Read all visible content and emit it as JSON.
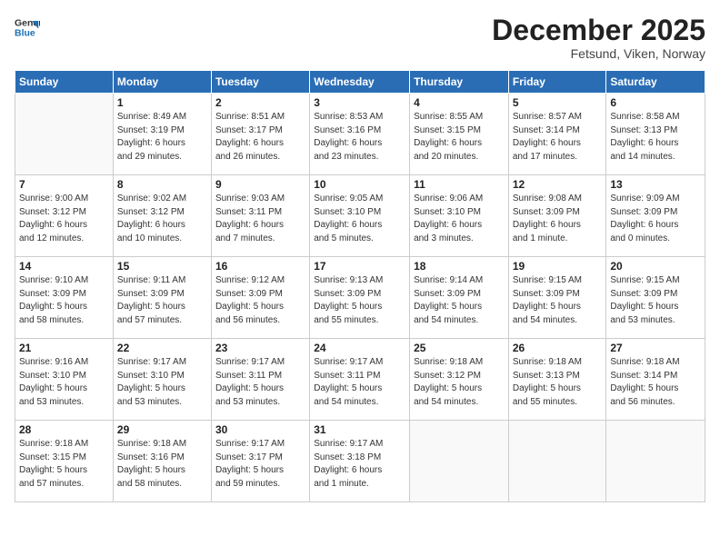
{
  "header": {
    "logo_line1": "General",
    "logo_line2": "Blue",
    "month": "December 2025",
    "location": "Fetsund, Viken, Norway"
  },
  "weekdays": [
    "Sunday",
    "Monday",
    "Tuesday",
    "Wednesday",
    "Thursday",
    "Friday",
    "Saturday"
  ],
  "weeks": [
    [
      {
        "day": "",
        "info": ""
      },
      {
        "day": "1",
        "info": "Sunrise: 8:49 AM\nSunset: 3:19 PM\nDaylight: 6 hours\nand 29 minutes."
      },
      {
        "day": "2",
        "info": "Sunrise: 8:51 AM\nSunset: 3:17 PM\nDaylight: 6 hours\nand 26 minutes."
      },
      {
        "day": "3",
        "info": "Sunrise: 8:53 AM\nSunset: 3:16 PM\nDaylight: 6 hours\nand 23 minutes."
      },
      {
        "day": "4",
        "info": "Sunrise: 8:55 AM\nSunset: 3:15 PM\nDaylight: 6 hours\nand 20 minutes."
      },
      {
        "day": "5",
        "info": "Sunrise: 8:57 AM\nSunset: 3:14 PM\nDaylight: 6 hours\nand 17 minutes."
      },
      {
        "day": "6",
        "info": "Sunrise: 8:58 AM\nSunset: 3:13 PM\nDaylight: 6 hours\nand 14 minutes."
      }
    ],
    [
      {
        "day": "7",
        "info": "Sunrise: 9:00 AM\nSunset: 3:12 PM\nDaylight: 6 hours\nand 12 minutes."
      },
      {
        "day": "8",
        "info": "Sunrise: 9:02 AM\nSunset: 3:12 PM\nDaylight: 6 hours\nand 10 minutes."
      },
      {
        "day": "9",
        "info": "Sunrise: 9:03 AM\nSunset: 3:11 PM\nDaylight: 6 hours\nand 7 minutes."
      },
      {
        "day": "10",
        "info": "Sunrise: 9:05 AM\nSunset: 3:10 PM\nDaylight: 6 hours\nand 5 minutes."
      },
      {
        "day": "11",
        "info": "Sunrise: 9:06 AM\nSunset: 3:10 PM\nDaylight: 6 hours\nand 3 minutes."
      },
      {
        "day": "12",
        "info": "Sunrise: 9:08 AM\nSunset: 3:09 PM\nDaylight: 6 hours\nand 1 minute."
      },
      {
        "day": "13",
        "info": "Sunrise: 9:09 AM\nSunset: 3:09 PM\nDaylight: 6 hours\nand 0 minutes."
      }
    ],
    [
      {
        "day": "14",
        "info": "Sunrise: 9:10 AM\nSunset: 3:09 PM\nDaylight: 5 hours\nand 58 minutes."
      },
      {
        "day": "15",
        "info": "Sunrise: 9:11 AM\nSunset: 3:09 PM\nDaylight: 5 hours\nand 57 minutes."
      },
      {
        "day": "16",
        "info": "Sunrise: 9:12 AM\nSunset: 3:09 PM\nDaylight: 5 hours\nand 56 minutes."
      },
      {
        "day": "17",
        "info": "Sunrise: 9:13 AM\nSunset: 3:09 PM\nDaylight: 5 hours\nand 55 minutes."
      },
      {
        "day": "18",
        "info": "Sunrise: 9:14 AM\nSunset: 3:09 PM\nDaylight: 5 hours\nand 54 minutes."
      },
      {
        "day": "19",
        "info": "Sunrise: 9:15 AM\nSunset: 3:09 PM\nDaylight: 5 hours\nand 54 minutes."
      },
      {
        "day": "20",
        "info": "Sunrise: 9:15 AM\nSunset: 3:09 PM\nDaylight: 5 hours\nand 53 minutes."
      }
    ],
    [
      {
        "day": "21",
        "info": "Sunrise: 9:16 AM\nSunset: 3:10 PM\nDaylight: 5 hours\nand 53 minutes."
      },
      {
        "day": "22",
        "info": "Sunrise: 9:17 AM\nSunset: 3:10 PM\nDaylight: 5 hours\nand 53 minutes."
      },
      {
        "day": "23",
        "info": "Sunrise: 9:17 AM\nSunset: 3:11 PM\nDaylight: 5 hours\nand 53 minutes."
      },
      {
        "day": "24",
        "info": "Sunrise: 9:17 AM\nSunset: 3:11 PM\nDaylight: 5 hours\nand 54 minutes."
      },
      {
        "day": "25",
        "info": "Sunrise: 9:18 AM\nSunset: 3:12 PM\nDaylight: 5 hours\nand 54 minutes."
      },
      {
        "day": "26",
        "info": "Sunrise: 9:18 AM\nSunset: 3:13 PM\nDaylight: 5 hours\nand 55 minutes."
      },
      {
        "day": "27",
        "info": "Sunrise: 9:18 AM\nSunset: 3:14 PM\nDaylight: 5 hours\nand 56 minutes."
      }
    ],
    [
      {
        "day": "28",
        "info": "Sunrise: 9:18 AM\nSunset: 3:15 PM\nDaylight: 5 hours\nand 57 minutes."
      },
      {
        "day": "29",
        "info": "Sunrise: 9:18 AM\nSunset: 3:16 PM\nDaylight: 5 hours\nand 58 minutes."
      },
      {
        "day": "30",
        "info": "Sunrise: 9:17 AM\nSunset: 3:17 PM\nDaylight: 5 hours\nand 59 minutes."
      },
      {
        "day": "31",
        "info": "Sunrise: 9:17 AM\nSunset: 3:18 PM\nDaylight: 6 hours\nand 1 minute."
      },
      {
        "day": "",
        "info": ""
      },
      {
        "day": "",
        "info": ""
      },
      {
        "day": "",
        "info": ""
      }
    ]
  ]
}
